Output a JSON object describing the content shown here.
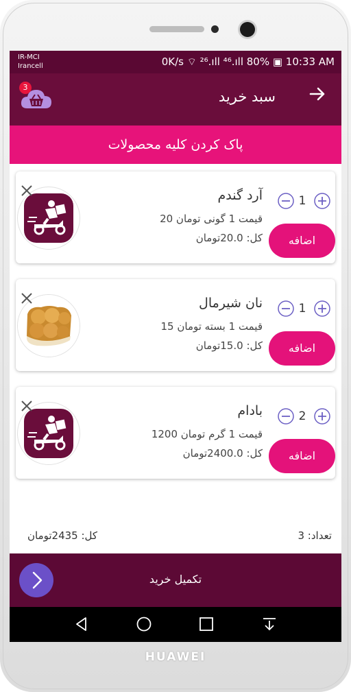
{
  "status": {
    "carrier_line1": "IR-MCI",
    "carrier_line2": "Irancell",
    "right": "0K/s ⌔ ²⁶.ıll ⁴⁶.ıll 80% ▣ 10:33 AM"
  },
  "header": {
    "title": "سبد خرید",
    "cart_badge": "3"
  },
  "clear_all_label": "پاک کردن کلیه محصولات",
  "items": [
    {
      "name": "آرد گندم",
      "price_text": "قیمت 1 گونی تومان   20",
      "total_text": "کل: 20.0تومان",
      "quantity": "1",
      "add_label": "اضافه",
      "image": "delivery-logo"
    },
    {
      "name": "نان شیرمال",
      "price_text": "قیمت 1 بسته تومان   15",
      "total_text": "کل: 15.0تومان",
      "quantity": "1",
      "add_label": "اضافه",
      "image": "bread-photo"
    },
    {
      "name": "بادام",
      "price_text": "قیمت 1 گرم تومان   1200",
      "total_text": "کل: 2400.0تومان",
      "quantity": "2",
      "add_label": "اضافه",
      "image": "delivery-logo"
    }
  ],
  "summary": {
    "total": "کل: 2435تومان",
    "count": "تعداد: 3"
  },
  "checkout_label": "تکمیل خرید",
  "device_brand": "HUAWEI",
  "colors": {
    "status_bar": "#5a0833",
    "app_bar": "#6a0d3b",
    "accent_pink": "#e7137a",
    "checkout_bar": "#5c0935",
    "checkout_button": "#6b50c8",
    "qty_icon": "#6b5fc4"
  }
}
